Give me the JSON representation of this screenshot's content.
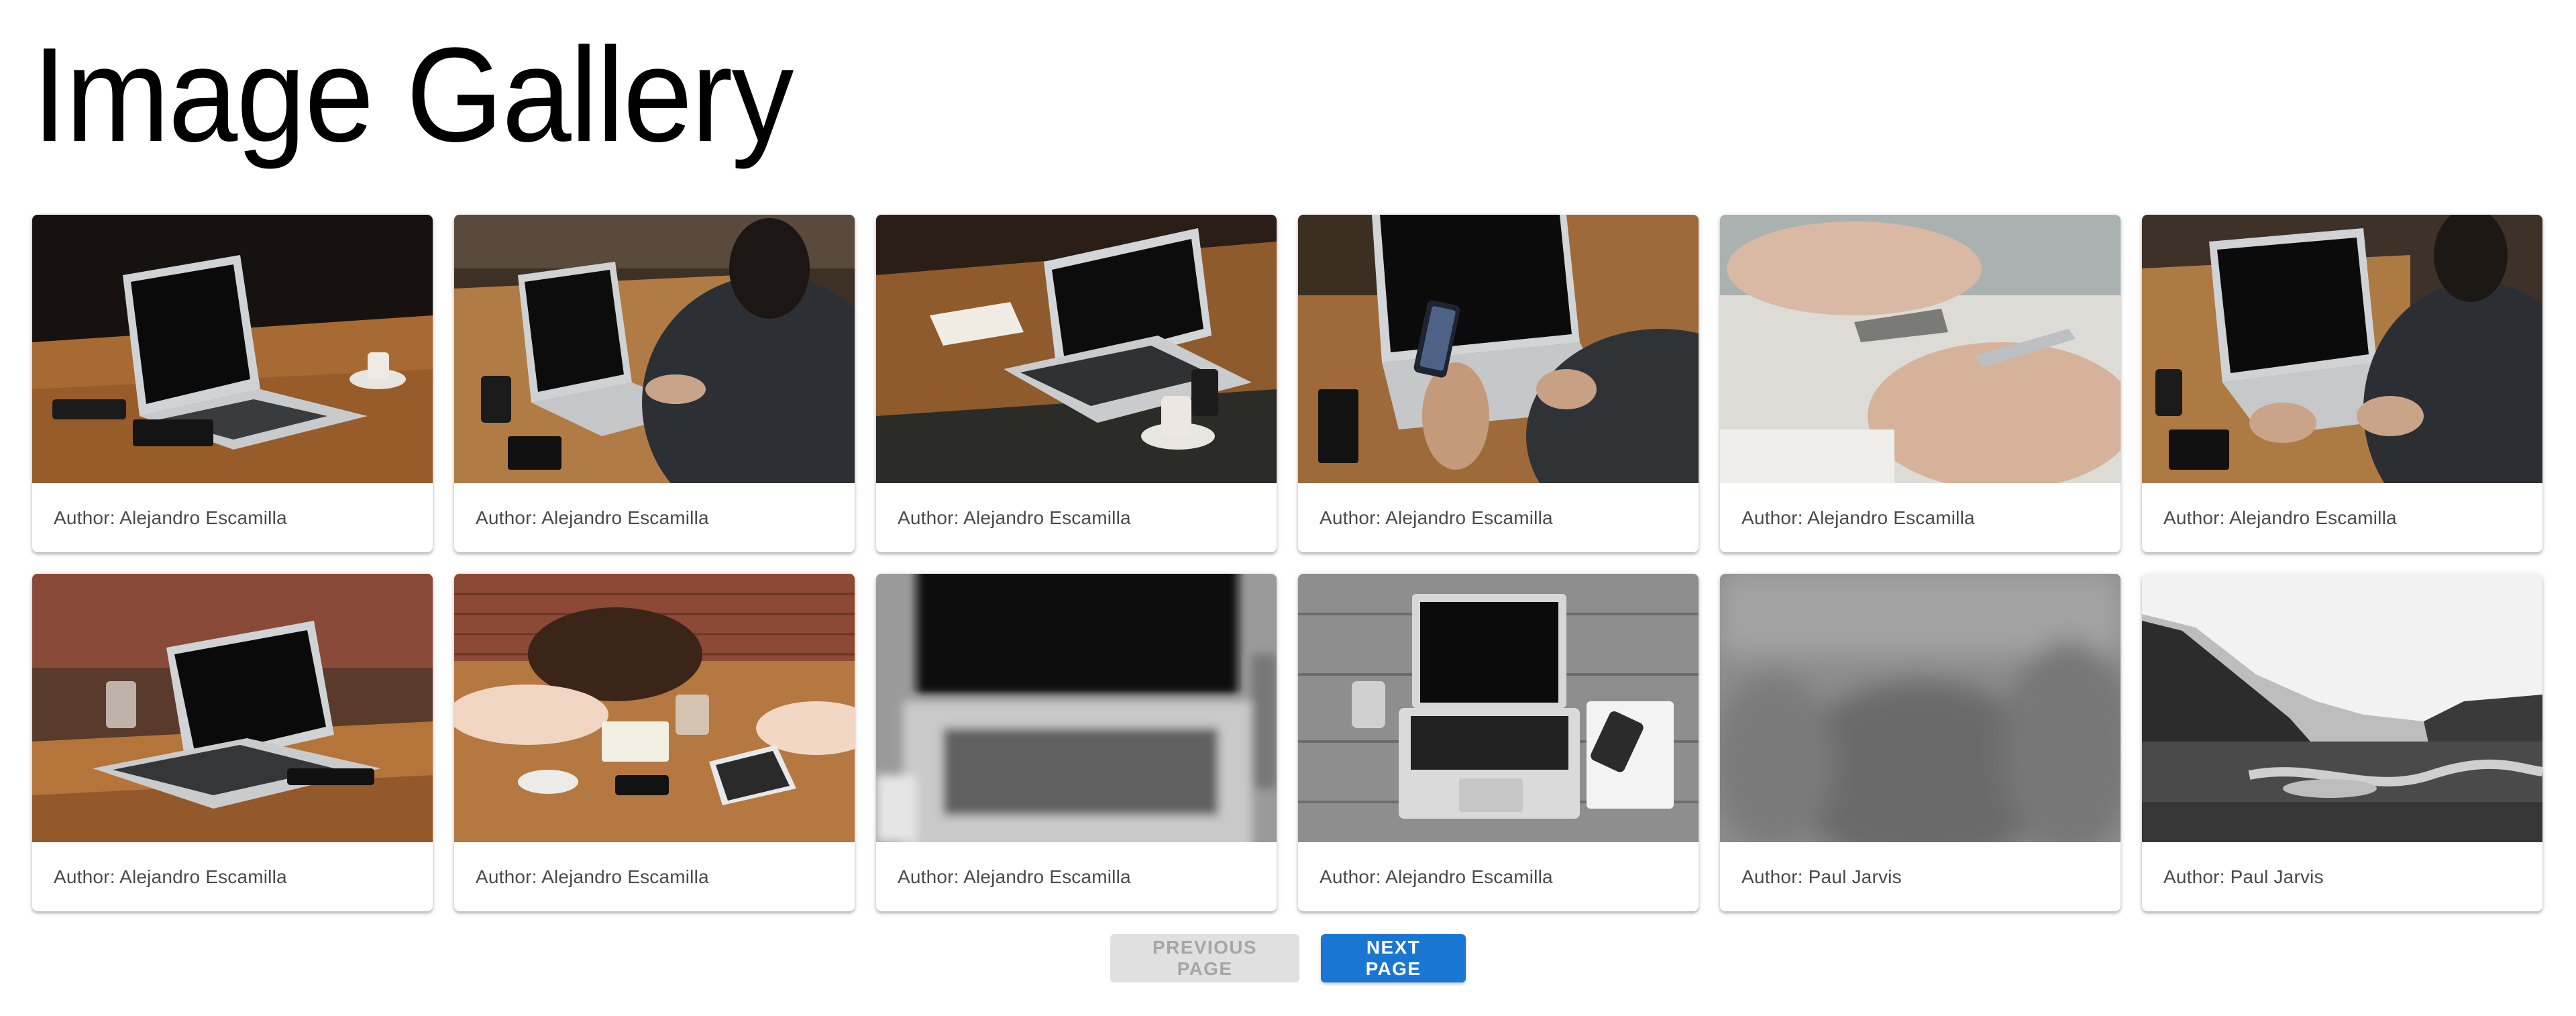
{
  "page": {
    "title": "Image Gallery"
  },
  "gallery": {
    "items": [
      {
        "author": "Author: Alejandro Escamilla",
        "image": "laptop-on-wooden-table-photo"
      },
      {
        "author": "Author: Alejandro Escamilla",
        "image": "person-typing-on-laptop-photo"
      },
      {
        "author": "Author: Alejandro Escamilla",
        "image": "laptop-with-notebook-and-coffee-photo"
      },
      {
        "author": "Author: Alejandro Escamilla",
        "image": "person-holding-phone-at-laptop-photo"
      },
      {
        "author": "Author: Alejandro Escamilla",
        "image": "hand-writing-with-pen-photo"
      },
      {
        "author": "Author: Alejandro Escamilla",
        "image": "person-typing-on-laptop-photo"
      },
      {
        "author": "Author: Alejandro Escamilla",
        "image": "laptop-with-glass-on-table-photo"
      },
      {
        "author": "Author: Alejandro Escamilla",
        "image": "people-at-table-with-tablet-photo"
      },
      {
        "author": "Author: Alejandro Escamilla",
        "image": "blurred-laptop-keyboard-photo"
      },
      {
        "author": "Author: Alejandro Escamilla",
        "image": "laptop-on-wood-grayscale-photo"
      },
      {
        "author": "Author: Paul Jarvis",
        "image": "blurred-gray-forest-photo"
      },
      {
        "author": "Author: Paul Jarvis",
        "image": "river-valley-landscape-photo"
      }
    ]
  },
  "pagination": {
    "previous_label": "Previous Page",
    "next_label": "Next Page",
    "previous_disabled": true
  },
  "colors": {
    "primary": "#1976d2",
    "disabled_bg": "#e0e0e0",
    "disabled_text": "#a6a6a6",
    "caption_text": "#4a4a4a"
  }
}
